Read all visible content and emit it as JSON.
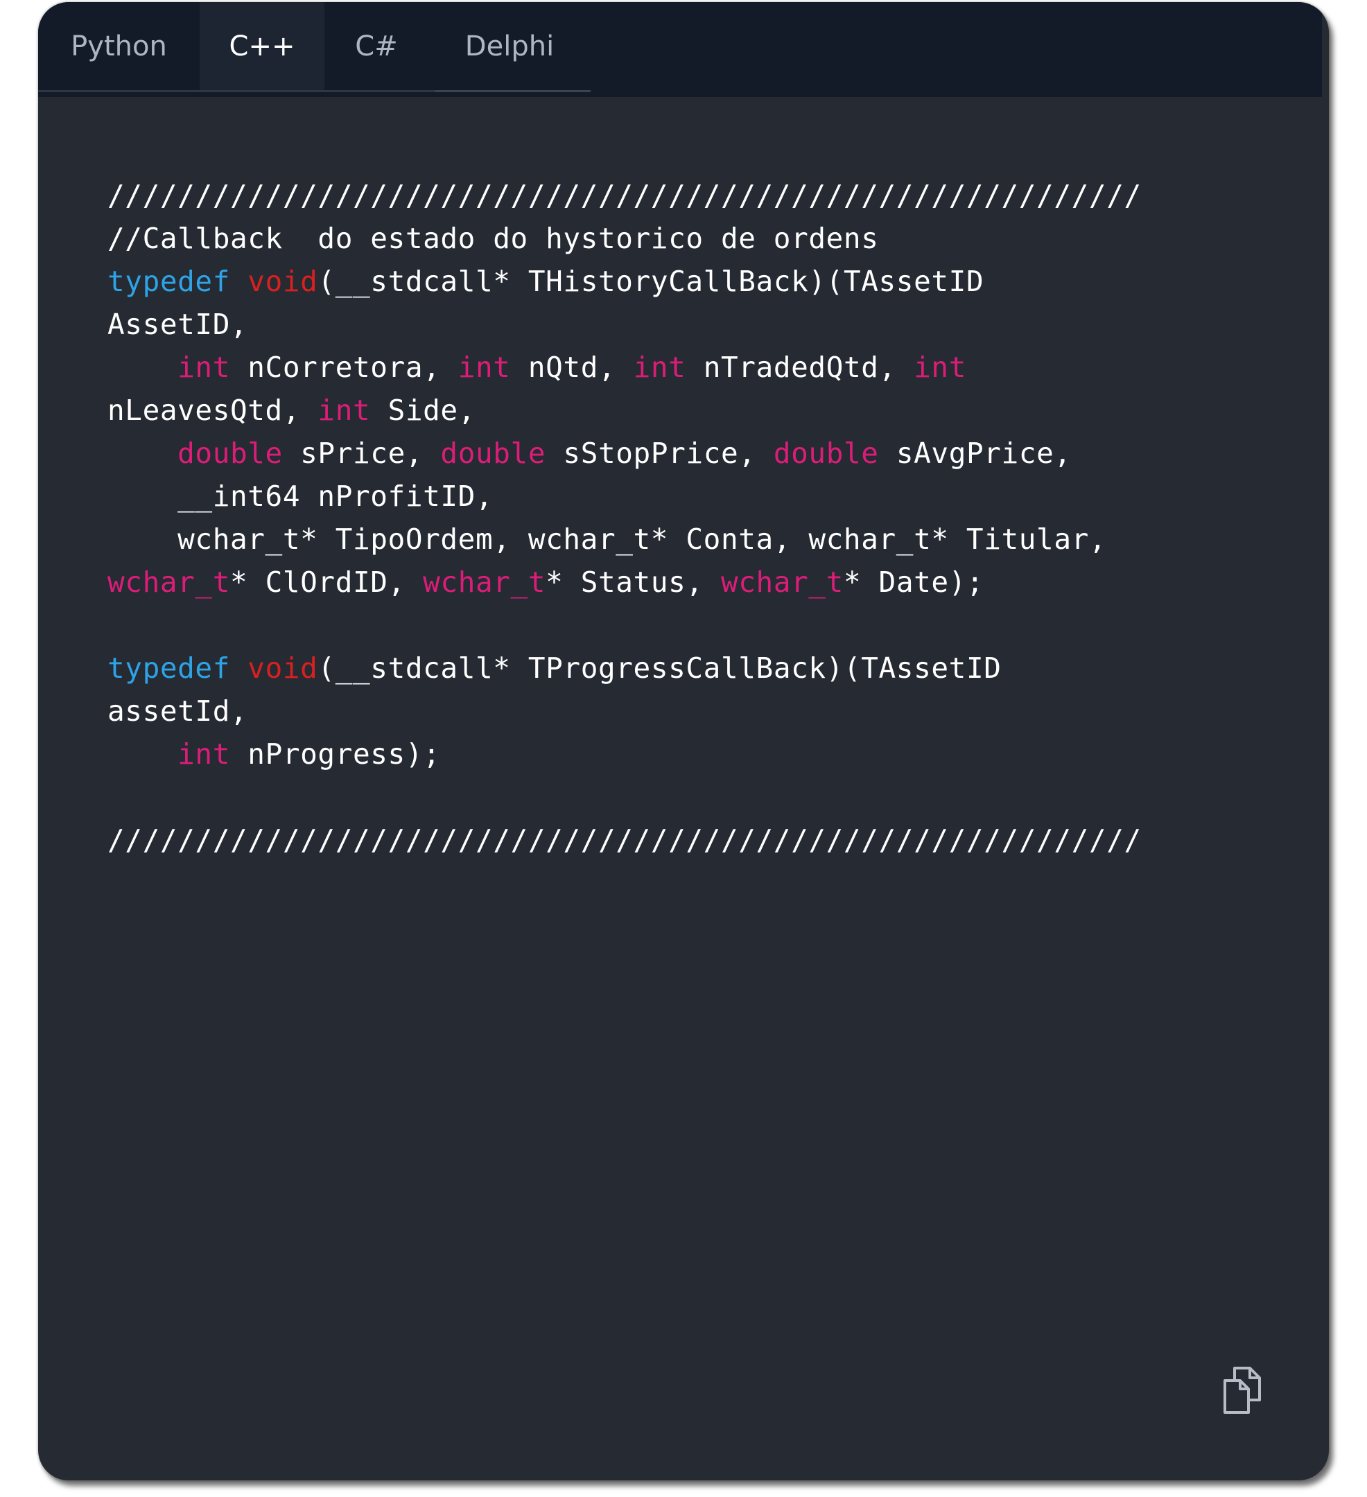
{
  "tabs": [
    {
      "label": "Python",
      "active": false
    },
    {
      "label": "C++",
      "active": true
    },
    {
      "label": "C#",
      "active": false
    },
    {
      "label": "Delphi",
      "active": false
    }
  ],
  "code": {
    "language": "C++",
    "lines": [
      [
        {
          "t": "///////////////////////////////////////////////////////////",
          "c": "plain"
        }
      ],
      [
        {
          "t": "//Callback  do estado do hystorico de ordens",
          "c": "plain"
        }
      ],
      [
        {
          "t": "typedef",
          "c": "blue"
        },
        {
          "t": " ",
          "c": "plain"
        },
        {
          "t": "void",
          "c": "red"
        },
        {
          "t": "(__stdcall* THistoryCallBack)(TAssetID",
          "c": "plain"
        }
      ],
      [
        {
          "t": "AssetID,",
          "c": "plain"
        }
      ],
      [
        {
          "t": "    ",
          "c": "plain"
        },
        {
          "t": "int",
          "c": "pink"
        },
        {
          "t": " nCorretora, ",
          "c": "plain"
        },
        {
          "t": "int",
          "c": "pink"
        },
        {
          "t": " nQtd, ",
          "c": "plain"
        },
        {
          "t": "int",
          "c": "pink"
        },
        {
          "t": " nTradedQtd, ",
          "c": "plain"
        },
        {
          "t": "int",
          "c": "pink"
        }
      ],
      [
        {
          "t": "nLeavesQtd, ",
          "c": "plain"
        },
        {
          "t": "int",
          "c": "pink"
        },
        {
          "t": " Side,",
          "c": "plain"
        }
      ],
      [
        {
          "t": "    ",
          "c": "plain"
        },
        {
          "t": "double",
          "c": "pink"
        },
        {
          "t": " sPrice, ",
          "c": "plain"
        },
        {
          "t": "double",
          "c": "pink"
        },
        {
          "t": " sStopPrice, ",
          "c": "plain"
        },
        {
          "t": "double",
          "c": "pink"
        },
        {
          "t": " sAvgPrice,",
          "c": "plain"
        }
      ],
      [
        {
          "t": "    __int64 nProfitID,",
          "c": "plain"
        }
      ],
      [
        {
          "t": "    wchar_t* TipoOrdem, wchar_t* Conta, wchar_t* Titular,",
          "c": "plain"
        }
      ],
      [
        {
          "t": "wchar_t",
          "c": "pink"
        },
        {
          "t": "* ClOrdID, ",
          "c": "plain"
        },
        {
          "t": "wchar_t",
          "c": "pink"
        },
        {
          "t": "* Status, ",
          "c": "plain"
        },
        {
          "t": "wchar_t",
          "c": "pink"
        },
        {
          "t": "* Date);",
          "c": "plain"
        }
      ],
      [],
      [
        {
          "t": "typedef",
          "c": "blue"
        },
        {
          "t": " ",
          "c": "plain"
        },
        {
          "t": "void",
          "c": "red"
        },
        {
          "t": "(__stdcall* TProgressCallBack)(TAssetID",
          "c": "plain"
        }
      ],
      [
        {
          "t": "assetId,",
          "c": "plain"
        }
      ],
      [
        {
          "t": "    ",
          "c": "plain"
        },
        {
          "t": "int",
          "c": "pink"
        },
        {
          "t": " nProgress);",
          "c": "plain"
        }
      ],
      [],
      [
        {
          "t": "///////////////////////////////////////////////////////////",
          "c": "plain"
        }
      ]
    ]
  },
  "copy_button": {
    "icon": "copy-icon"
  },
  "colors": {
    "window_bg": "#252a33",
    "tabbar_bg": "#131a28",
    "active_tab_bg": "#1d2533",
    "keyword_blue": "#2ea3e6",
    "keyword_red": "#d8211f",
    "keyword_pink": "#dc1d78",
    "text": "#ffffff"
  }
}
